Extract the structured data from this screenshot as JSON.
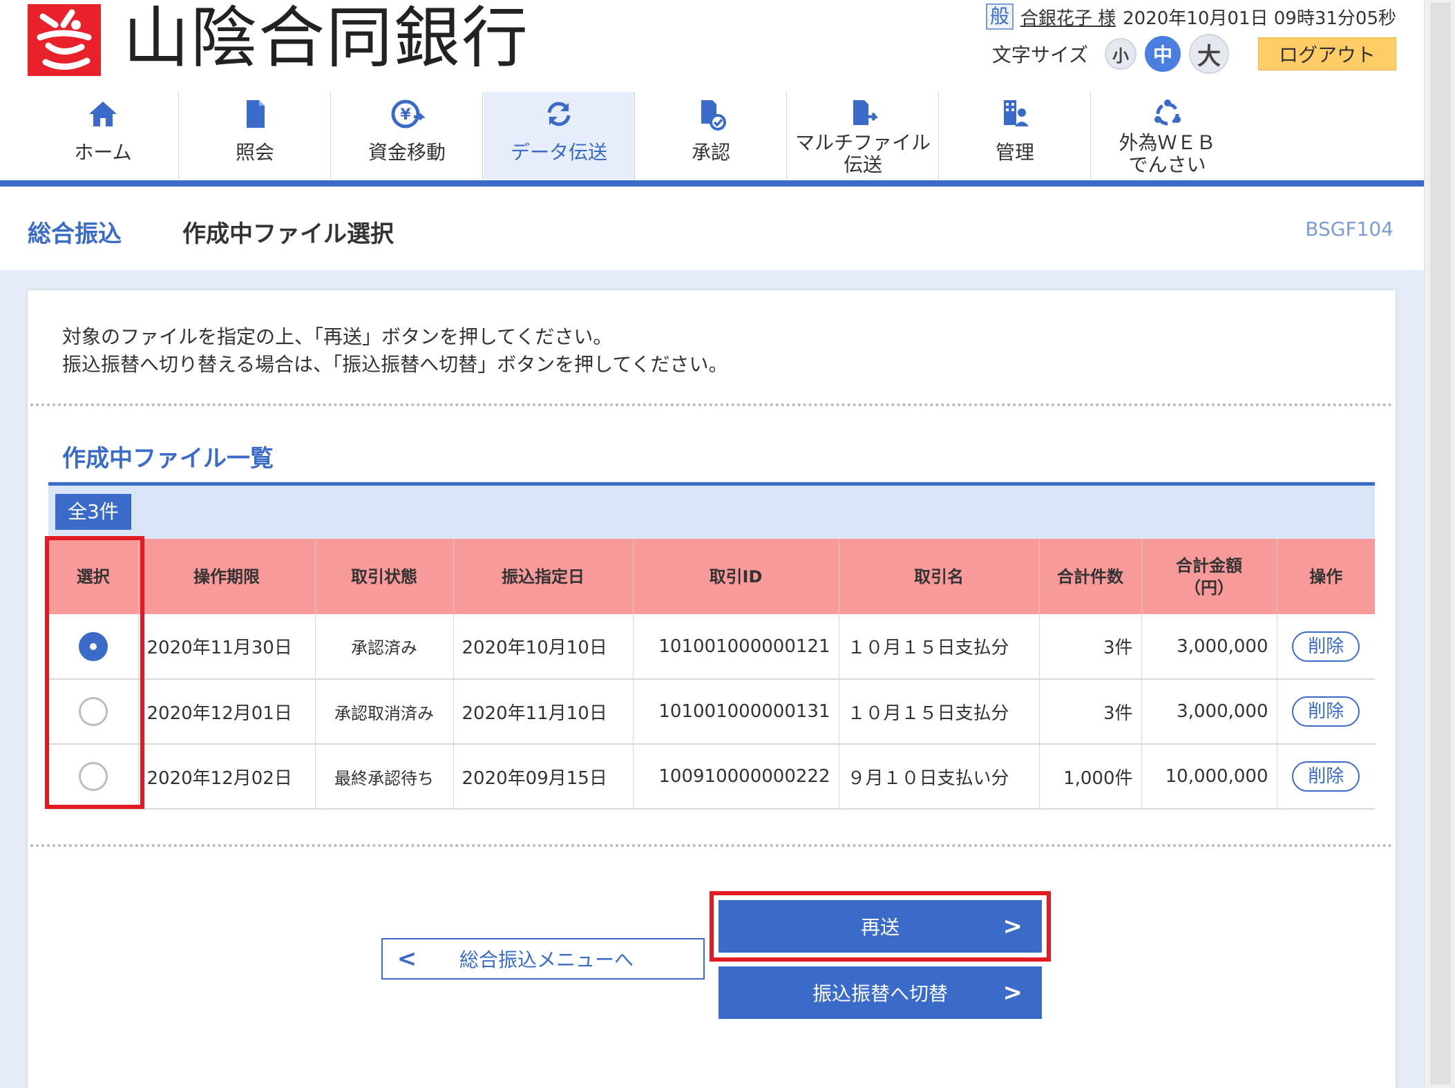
{
  "header": {
    "bank_name": "山陰合同銀行",
    "user_badge": "般",
    "user_name": "合銀花子 様",
    "datetime": "2020年10月01日 09時31分05秒",
    "font_size_label": "文字サイズ",
    "font_small": "小",
    "font_medium": "中",
    "font_large": "大",
    "logout_label": "ログアウト"
  },
  "nav": {
    "items": [
      {
        "label": "ホーム",
        "icon": "home-icon"
      },
      {
        "label": "照会",
        "icon": "document-icon"
      },
      {
        "label": "資金移動",
        "icon": "yen-transfer-icon"
      },
      {
        "label": "データ伝送",
        "icon": "sync-icon"
      },
      {
        "label": "承認",
        "icon": "approve-icon"
      },
      {
        "label_line1": "マルチファイル",
        "label_line2": "伝送",
        "icon": "multi-file-icon"
      },
      {
        "label": "管理",
        "icon": "admin-icon"
      },
      {
        "label_line1": "外為ＷＥＢ",
        "label_line2": "でんさい",
        "icon": "forex-icon"
      }
    ],
    "active_index": 3
  },
  "page": {
    "category": "総合振込",
    "title": "作成中ファイル選択",
    "screen_code": "BSGF104"
  },
  "instructions": {
    "line1": "対象のファイルを指定の上、「再送」ボタンを押してください。",
    "line2": "振込振替へ切り替える場合は、「振込振替へ切替」ボタンを押してください。"
  },
  "list": {
    "title": "作成中ファイル一覧",
    "count_label": "全3件",
    "columns": {
      "select": "選択",
      "deadline": "操作期限",
      "status": "取引状態",
      "transfer_date": "振込指定日",
      "trade_id": "取引ID",
      "trade_name": "取引名",
      "total_count": "合計件数",
      "total_amount_line1": "合計金額",
      "total_amount_line2": "（円）",
      "operation": "操作"
    },
    "rows": [
      {
        "selected": true,
        "deadline": "2020年11月30日",
        "status": "承認済み",
        "transfer_date": "2020年10月10日",
        "trade_id": "101001000000121",
        "trade_name": "１０月１５日支払分",
        "total_count": "3件",
        "total_amount": "3,000,000",
        "delete_label": "削除"
      },
      {
        "selected": false,
        "deadline": "2020年12月01日",
        "status": "承認取消済み",
        "transfer_date": "2020年11月10日",
        "trade_id": "101001000000131",
        "trade_name": "１０月１５日支払分",
        "total_count": "3件",
        "total_amount": "3,000,000",
        "delete_label": "削除"
      },
      {
        "selected": false,
        "deadline": "2020年12月02日",
        "status": "最終承認待ち",
        "transfer_date": "2020年09月15日",
        "trade_id": "100910000000222",
        "trade_name": "９月１０日支払い分",
        "total_count": "1,000件",
        "total_amount": "10,000,000",
        "delete_label": "削除"
      }
    ]
  },
  "buttons": {
    "back": "総合振込メニューへ",
    "resend": "再送",
    "switch": "振込振替へ切替"
  },
  "colors": {
    "accent": "#3a6bc9",
    "table_header": "#f99a9a",
    "highlight": "#e21b23",
    "logout": "#ffcc66",
    "logo": "#e8212a"
  }
}
